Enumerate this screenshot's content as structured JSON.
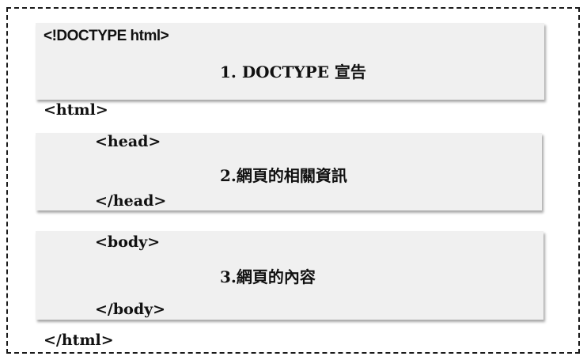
{
  "doctype_section": {
    "tag": "<!DOCTYPE html>",
    "caption": "1. DOCTYPE 宣告"
  },
  "html_open": "<html>",
  "head_section": {
    "open_tag": "<head>",
    "caption": "2.網頁的相關資訊",
    "close_tag": "</head>"
  },
  "body_section": {
    "open_tag": "<body>",
    "caption": "3.網頁的內容",
    "close_tag": "</body>"
  },
  "html_close": "</html>",
  "colors": {
    "box_fill": "#f0f0f0",
    "border": "#1a1a1a",
    "text": "#111111"
  }
}
